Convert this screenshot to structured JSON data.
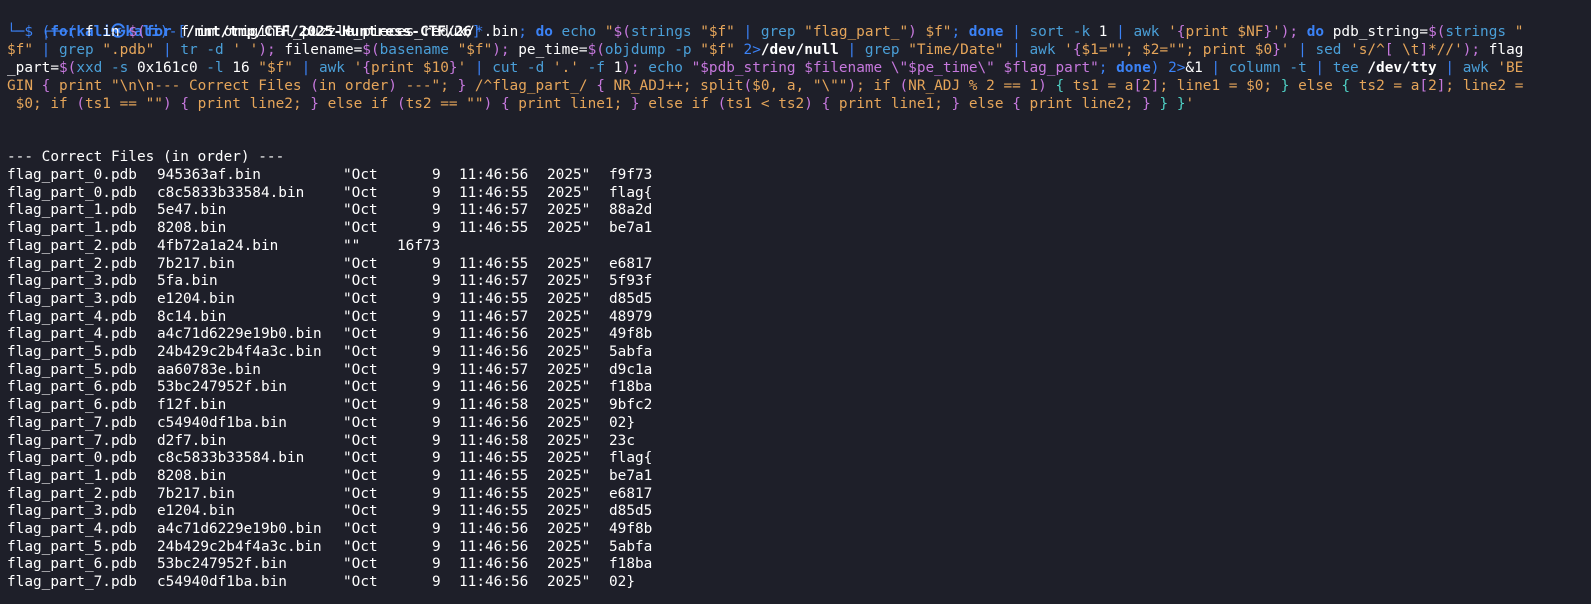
{
  "prompt": {
    "open": "┌──(",
    "user": "kali",
    "at": "㉿",
    "host": "kali",
    "mid": ")-[",
    "path": "/mnt/tmp/CTF/2025-Huntress-CTF/26",
    "close": "]",
    "second_line": "└─$"
  },
  "command": {
    "line1": [
      {
        "t": " ",
        "c": "#ffffff"
      },
      {
        "t": "(",
        "c": "#3b82f6"
      },
      {
        "t": "for",
        "c": "#3b82f6",
        "b": true
      },
      {
        "t": " f in ",
        "c": "#ffffff"
      },
      {
        "t": "$(",
        "c": "#c678dd"
      },
      {
        "t": "for",
        "c": "#3b82f6",
        "b": true
      },
      {
        "t": " f in original_puzzle_pieces_redux/",
        "c": "#ffffff"
      },
      {
        "t": "*",
        "c": "#3b82f6"
      },
      {
        "t": ".bin",
        "c": "#ffffff"
      },
      {
        "t": "; ",
        "c": "#3b82f6"
      },
      {
        "t": "do",
        "c": "#3b82f6",
        "b": true
      },
      {
        "t": " echo ",
        "c": "#4a9fd8"
      },
      {
        "t": "\"",
        "c": "#e5a55a"
      },
      {
        "t": "$(",
        "c": "#c678dd"
      },
      {
        "t": "strings ",
        "c": "#4a9fd8"
      },
      {
        "t": "\"$f\"",
        "c": "#e5a55a"
      },
      {
        "t": " | ",
        "c": "#3b82f6"
      },
      {
        "t": "grep ",
        "c": "#4a9fd8"
      },
      {
        "t": "\"flag_part_\"",
        "c": "#e5a55a"
      },
      {
        "t": ") ",
        "c": "#c678dd"
      },
      {
        "t": "$f\"",
        "c": "#e5a55a"
      },
      {
        "t": "; ",
        "c": "#3b82f6"
      },
      {
        "t": "done",
        "c": "#3b82f6",
        "b": true
      },
      {
        "t": " | ",
        "c": "#3b82f6"
      },
      {
        "t": "sort ",
        "c": "#4a9fd8"
      },
      {
        "t": "-k ",
        "c": "#4a9fd8"
      },
      {
        "t": "1 ",
        "c": "#ffffff"
      },
      {
        "t": "| ",
        "c": "#3b82f6"
      },
      {
        "t": "awk ",
        "c": "#4a9fd8"
      },
      {
        "t": "'",
        "c": "#e5a55a"
      },
      {
        "t": "{",
        "c": "#c678dd"
      },
      {
        "t": "print $NF",
        "c": "#e5a55a"
      },
      {
        "t": "}",
        "c": "#c678dd"
      },
      {
        "t": "'",
        "c": "#e5a55a"
      },
      {
        "t": "); ",
        "c": "#c678dd"
      },
      {
        "t": "do",
        "c": "#3b82f6",
        "b": true
      },
      {
        "t": " pdb_string=",
        "c": "#ffffff"
      },
      {
        "t": "$(",
        "c": "#c678dd"
      },
      {
        "t": "strings ",
        "c": "#4a9fd8"
      },
      {
        "t": "\"",
        "c": "#e5a55a"
      }
    ],
    "line2": [
      {
        "t": "$f\"",
        "c": "#e5a55a"
      },
      {
        "t": " | ",
        "c": "#3b82f6"
      },
      {
        "t": "grep ",
        "c": "#4a9fd8"
      },
      {
        "t": "\".pdb\"",
        "c": "#e5a55a"
      },
      {
        "t": " | ",
        "c": "#3b82f6"
      },
      {
        "t": "tr ",
        "c": "#4a9fd8"
      },
      {
        "t": "-d ",
        "c": "#4a9fd8"
      },
      {
        "t": "' '",
        "c": "#e5a55a"
      },
      {
        "t": "); ",
        "c": "#c678dd"
      },
      {
        "t": "filename=",
        "c": "#ffffff"
      },
      {
        "t": "$(",
        "c": "#c678dd"
      },
      {
        "t": "basename ",
        "c": "#4a9fd8"
      },
      {
        "t": "\"$f\"",
        "c": "#e5a55a"
      },
      {
        "t": "); ",
        "c": "#c678dd"
      },
      {
        "t": "pe_time=",
        "c": "#ffffff"
      },
      {
        "t": "$(",
        "c": "#c678dd"
      },
      {
        "t": "objdump ",
        "c": "#4a9fd8"
      },
      {
        "t": "-p ",
        "c": "#4a9fd8"
      },
      {
        "t": "\"$f\" ",
        "c": "#e5a55a"
      },
      {
        "t": "2>",
        "c": "#3b82f6"
      },
      {
        "t": "/dev/null",
        "c": "#ffffff",
        "b": true
      },
      {
        "t": " | ",
        "c": "#3b82f6"
      },
      {
        "t": "grep ",
        "c": "#4a9fd8"
      },
      {
        "t": "\"Time/Date\"",
        "c": "#e5a55a"
      },
      {
        "t": " | ",
        "c": "#3b82f6"
      },
      {
        "t": "awk ",
        "c": "#4a9fd8"
      },
      {
        "t": "'",
        "c": "#e5a55a"
      },
      {
        "t": "{",
        "c": "#c678dd"
      },
      {
        "t": "$1=\"\"; $2=\"\"; print $0",
        "c": "#e5a55a"
      },
      {
        "t": "}",
        "c": "#c678dd"
      },
      {
        "t": "'",
        "c": "#e5a55a"
      },
      {
        "t": " | ",
        "c": "#3b82f6"
      },
      {
        "t": "sed ",
        "c": "#4a9fd8"
      },
      {
        "t": "'s/^",
        "c": "#e5a55a"
      },
      {
        "t": "[",
        "c": "#c678dd"
      },
      {
        "t": " \\t",
        "c": "#e5a55a"
      },
      {
        "t": "]",
        "c": "#c678dd"
      },
      {
        "t": "*//'",
        "c": "#e5a55a"
      },
      {
        "t": "); ",
        "c": "#c678dd"
      },
      {
        "t": "flag",
        "c": "#ffffff"
      }
    ],
    "line3": [
      {
        "t": "_part=",
        "c": "#ffffff"
      },
      {
        "t": "$(",
        "c": "#c678dd"
      },
      {
        "t": "xxd ",
        "c": "#4a9fd8"
      },
      {
        "t": "-s ",
        "c": "#4a9fd8"
      },
      {
        "t": "0x161c0 ",
        "c": "#ffffff"
      },
      {
        "t": "-l ",
        "c": "#4a9fd8"
      },
      {
        "t": "16 ",
        "c": "#ffffff"
      },
      {
        "t": "\"$f\"",
        "c": "#e5a55a"
      },
      {
        "t": " | ",
        "c": "#3b82f6"
      },
      {
        "t": "awk ",
        "c": "#4a9fd8"
      },
      {
        "t": "'",
        "c": "#e5a55a"
      },
      {
        "t": "{",
        "c": "#c678dd"
      },
      {
        "t": "print $10",
        "c": "#e5a55a"
      },
      {
        "t": "}",
        "c": "#c678dd"
      },
      {
        "t": "'",
        "c": "#e5a55a"
      },
      {
        "t": " | ",
        "c": "#3b82f6"
      },
      {
        "t": "cut ",
        "c": "#4a9fd8"
      },
      {
        "t": "-d ",
        "c": "#4a9fd8"
      },
      {
        "t": "'.'",
        "c": "#e5a55a"
      },
      {
        "t": " -f ",
        "c": "#4a9fd8"
      },
      {
        "t": "1",
        "c": "#ffffff"
      },
      {
        "t": "); ",
        "c": "#c678dd"
      },
      {
        "t": "echo ",
        "c": "#4a9fd8"
      },
      {
        "t": "\"$pdb_string $filename \\\"$pe_time\\\" $flag_part\"",
        "c": "#c678dd"
      },
      {
        "t": "; ",
        "c": "#3b82f6"
      },
      {
        "t": "done",
        "c": "#3b82f6",
        "b": true
      },
      {
        "t": ") ",
        "c": "#3b82f6"
      },
      {
        "t": "2>",
        "c": "#3b82f6"
      },
      {
        "t": "&1",
        "c": "#ffffff"
      },
      {
        "t": " | ",
        "c": "#3b82f6"
      },
      {
        "t": "column ",
        "c": "#4a9fd8"
      },
      {
        "t": "-t ",
        "c": "#4a9fd8"
      },
      {
        "t": "| ",
        "c": "#3b82f6"
      },
      {
        "t": "tee ",
        "c": "#4a9fd8"
      },
      {
        "t": "/dev/tty",
        "c": "#ffffff",
        "b": true
      },
      {
        "t": " | ",
        "c": "#3b82f6"
      },
      {
        "t": "awk ",
        "c": "#4a9fd8"
      },
      {
        "t": "'BE",
        "c": "#e5a55a"
      }
    ],
    "line4": [
      {
        "t": "GIN ",
        "c": "#e5a55a"
      },
      {
        "t": "{",
        "c": "#c678dd"
      },
      {
        "t": " print \"\\n\\n--- Correct Files ",
        "c": "#e5a55a"
      },
      {
        "t": "(",
        "c": "#c678dd"
      },
      {
        "t": "in order",
        "c": "#e5a55a"
      },
      {
        "t": ")",
        "c": "#c678dd"
      },
      {
        "t": " ---\"; ",
        "c": "#e5a55a"
      },
      {
        "t": "}",
        "c": "#c678dd"
      },
      {
        "t": " /^flag_part_/ ",
        "c": "#e5a55a"
      },
      {
        "t": "{",
        "c": "#c678dd"
      },
      {
        "t": " NR_ADJ++; split",
        "c": "#e5a55a"
      },
      {
        "t": "(",
        "c": "#c678dd"
      },
      {
        "t": "$0, a, \"\\\"\"",
        "c": "#e5a55a"
      },
      {
        "t": ")",
        "c": "#c678dd"
      },
      {
        "t": "; if ",
        "c": "#e5a55a"
      },
      {
        "t": "(",
        "c": "#c678dd"
      },
      {
        "t": "NR_ADJ % 2 == 1",
        "c": "#e5a55a"
      },
      {
        "t": ")",
        "c": "#c678dd"
      },
      {
        "t": " ",
        "c": "#e5a55a"
      },
      {
        "t": "{",
        "c": "#4fd1c5"
      },
      {
        "t": " ts1 = a",
        "c": "#e5a55a"
      },
      {
        "t": "[",
        "c": "#c678dd"
      },
      {
        "t": "2",
        "c": "#e5a55a"
      },
      {
        "t": "]",
        "c": "#c678dd"
      },
      {
        "t": "; line1 = $0; ",
        "c": "#e5a55a"
      },
      {
        "t": "}",
        "c": "#4fd1c5"
      },
      {
        "t": " else ",
        "c": "#e5a55a"
      },
      {
        "t": "{",
        "c": "#4fd1c5"
      },
      {
        "t": " ts2 = a",
        "c": "#e5a55a"
      },
      {
        "t": "[",
        "c": "#c678dd"
      },
      {
        "t": "2",
        "c": "#e5a55a"
      },
      {
        "t": "]",
        "c": "#c678dd"
      },
      {
        "t": "; line2 =",
        "c": "#e5a55a"
      }
    ],
    "line5": [
      {
        "t": " $0; if ",
        "c": "#e5a55a"
      },
      {
        "t": "(",
        "c": "#c678dd"
      },
      {
        "t": "ts1 == \"\"",
        "c": "#e5a55a"
      },
      {
        "t": ")",
        "c": "#c678dd"
      },
      {
        "t": " ",
        "c": "#e5a55a"
      },
      {
        "t": "{",
        "c": "#c678dd"
      },
      {
        "t": " print line2; ",
        "c": "#e5a55a"
      },
      {
        "t": "}",
        "c": "#c678dd"
      },
      {
        "t": " else if ",
        "c": "#e5a55a"
      },
      {
        "t": "(",
        "c": "#c678dd"
      },
      {
        "t": "ts2 == \"\"",
        "c": "#e5a55a"
      },
      {
        "t": ")",
        "c": "#c678dd"
      },
      {
        "t": " ",
        "c": "#e5a55a"
      },
      {
        "t": "{",
        "c": "#c678dd"
      },
      {
        "t": " print line1; ",
        "c": "#e5a55a"
      },
      {
        "t": "}",
        "c": "#c678dd"
      },
      {
        "t": " else if ",
        "c": "#e5a55a"
      },
      {
        "t": "(",
        "c": "#c678dd"
      },
      {
        "t": "ts1 < ts2",
        "c": "#e5a55a"
      },
      {
        "t": ")",
        "c": "#c678dd"
      },
      {
        "t": " ",
        "c": "#e5a55a"
      },
      {
        "t": "{",
        "c": "#c678dd"
      },
      {
        "t": " print line1; ",
        "c": "#e5a55a"
      },
      {
        "t": "}",
        "c": "#c678dd"
      },
      {
        "t": " else ",
        "c": "#e5a55a"
      },
      {
        "t": "{",
        "c": "#c678dd"
      },
      {
        "t": " print line2; ",
        "c": "#e5a55a"
      },
      {
        "t": "}",
        "c": "#c678dd"
      },
      {
        "t": " ",
        "c": "#e5a55a"
      },
      {
        "t": "}",
        "c": "#4fd1c5"
      },
      {
        "t": " ",
        "c": "#e5a55a"
      },
      {
        "t": "}",
        "c": "#4fd1c5"
      },
      {
        "t": "'",
        "c": "#e5a55a"
      }
    ]
  },
  "output": {
    "header": "--- Correct Files (in order) ---",
    "rows": [
      [
        "flag_part_0.pdb",
        "945363af.bin",
        "\"Oct",
        "9",
        "11:46:56",
        "2025\"",
        "f9f73"
      ],
      [
        "flag_part_0.pdb",
        "c8c5833b33584.bin",
        "\"Oct",
        "9",
        "11:46:55",
        "2025\"",
        "flag{"
      ],
      [
        "flag_part_1.pdb",
        "5e47.bin",
        "\"Oct",
        "9",
        "11:46:57",
        "2025\"",
        "88a2d"
      ],
      [
        "flag_part_1.pdb",
        "8208.bin",
        "\"Oct",
        "9",
        "11:46:55",
        "2025\"",
        "be7a1"
      ],
      [
        "flag_part_2.pdb",
        "4fb72a1a24.bin",
        "\"\"",
        "16f73",
        "",
        "",
        ""
      ],
      [
        "flag_part_2.pdb",
        "7b217.bin",
        "\"Oct",
        "9",
        "11:46:55",
        "2025\"",
        "e6817"
      ],
      [
        "flag_part_3.pdb",
        "5fa.bin",
        "\"Oct",
        "9",
        "11:46:57",
        "2025\"",
        "5f93f"
      ],
      [
        "flag_part_3.pdb",
        "e1204.bin",
        "\"Oct",
        "9",
        "11:46:55",
        "2025\"",
        "d85d5"
      ],
      [
        "flag_part_4.pdb",
        "8c14.bin",
        "\"Oct",
        "9",
        "11:46:57",
        "2025\"",
        "48979"
      ],
      [
        "flag_part_4.pdb",
        "a4c71d6229e19b0.bin",
        "\"Oct",
        "9",
        "11:46:56",
        "2025\"",
        "49f8b"
      ],
      [
        "flag_part_5.pdb",
        "24b429c2b4f4a3c.bin",
        "\"Oct",
        "9",
        "11:46:56",
        "2025\"",
        "5abfa"
      ],
      [
        "flag_part_5.pdb",
        "aa60783e.bin",
        "\"Oct",
        "9",
        "11:46:57",
        "2025\"",
        "d9c1a"
      ],
      [
        "flag_part_6.pdb",
        "53bc247952f.bin",
        "\"Oct",
        "9",
        "11:46:56",
        "2025\"",
        "f18ba"
      ],
      [
        "flag_part_6.pdb",
        "f12f.bin",
        "\"Oct",
        "9",
        "11:46:58",
        "2025\"",
        "9bfc2"
      ],
      [
        "flag_part_7.pdb",
        "c54940df1ba.bin",
        "\"Oct",
        "9",
        "11:46:56",
        "2025\"",
        "02}"
      ],
      [
        "flag_part_7.pdb",
        "d2f7.bin",
        "\"Oct",
        "9",
        "11:46:58",
        "2025\"",
        "23c"
      ],
      [
        "flag_part_0.pdb",
        "c8c5833b33584.bin",
        "\"Oct",
        "9",
        "11:46:55",
        "2025\"",
        "flag{"
      ],
      [
        "flag_part_1.pdb",
        "8208.bin",
        "\"Oct",
        "9",
        "11:46:55",
        "2025\"",
        "be7a1"
      ],
      [
        "flag_part_2.pdb",
        "7b217.bin",
        "\"Oct",
        "9",
        "11:46:55",
        "2025\"",
        "e6817"
      ],
      [
        "flag_part_3.pdb",
        "e1204.bin",
        "\"Oct",
        "9",
        "11:46:55",
        "2025\"",
        "d85d5"
      ],
      [
        "flag_part_4.pdb",
        "a4c71d6229e19b0.bin",
        "\"Oct",
        "9",
        "11:46:56",
        "2025\"",
        "49f8b"
      ],
      [
        "flag_part_5.pdb",
        "24b429c2b4f4a3c.bin",
        "\"Oct",
        "9",
        "11:46:56",
        "2025\"",
        "5abfa"
      ],
      [
        "flag_part_6.pdb",
        "53bc247952f.bin",
        "\"Oct",
        "9",
        "11:46:56",
        "2025\"",
        "f18ba"
      ],
      [
        "flag_part_7.pdb",
        "c54940df1ba.bin",
        "\"Oct",
        "9",
        "11:46:56",
        "2025\"",
        "02}"
      ]
    ]
  },
  "colors": {
    "background": "#1e1f29",
    "prompt_blue": "#3b82f6",
    "text": "#ffffff"
  }
}
